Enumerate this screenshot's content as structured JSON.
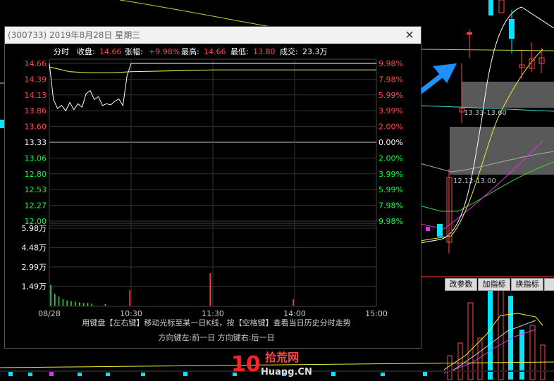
{
  "popup": {
    "title": "(300733) 2019年8月28日 星期三",
    "close_glyph": "✕",
    "info_label": "分时",
    "close_label": "收盘:",
    "close_value": "14.66",
    "change_label": "张幅:",
    "change_value": "+9.98%",
    "high_label": "最高:",
    "high_value": "14.66",
    "low_label": "最低:",
    "low_value": "13.80",
    "volume_label": "成交:",
    "volume_value": "23.3万",
    "price_ticks": [
      "14.66",
      "14.39",
      "14.13",
      "13.86",
      "13.60",
      "13.33",
      "13.06",
      "12.80",
      "12.53",
      "12.27",
      "12.00"
    ],
    "pct_ticks": [
      "9.98%",
      "7.98%",
      "5.99%",
      "3.99%",
      "2.00%",
      "0.00%",
      "2.00%",
      "3.99%",
      "5.99%",
      "7.98%",
      "9.98%"
    ],
    "volume_ticks": [
      "5.98万",
      "4.48万",
      "2.99万",
      "1.49万"
    ],
    "time_ticks": [
      "08/28",
      "10:30",
      "11:30",
      "14:00",
      "15:00"
    ],
    "hint_line1": "用键盘【左右键】移动光标至某一日K线，按【空格键】查看当日历史分时走势",
    "hint_line2": "方向键左:前一日    方向键右:后一日"
  },
  "right_panel": {
    "buttons": [
      "改参数",
      "加指标",
      "换指标"
    ],
    "range_label_top": "13.33-13.60",
    "range_label_bottom": "12.12-13.00"
  },
  "watermark": {
    "logo_number": "10",
    "site_cn": "拾荒网",
    "site_en": "Huang.CN"
  },
  "colors": {
    "background": "#000000",
    "up_red": "#ff4a4a",
    "down_green": "#00ff3c",
    "neutral_white": "#ffffff",
    "average_yellow": "#ffff55",
    "arrow_blue": "#1e90ff"
  },
  "chart_data": {
    "type": "line",
    "title": "分时",
    "x_ticks": [
      "08/28",
      "10:30",
      "11:30",
      "14:00",
      "15:00"
    ],
    "ylim": [
      12.0,
      14.66
    ],
    "prev_close": 13.33,
    "price_series": {
      "x": [
        "09:30",
        "09:33",
        "09:36",
        "09:39",
        "09:42",
        "09:45",
        "09:48",
        "09:51",
        "09:54",
        "09:57",
        "10:00",
        "10:03",
        "10:06",
        "10:09",
        "10:12",
        "10:15",
        "10:18",
        "10:21",
        "10:24",
        "10:27",
        "10:30",
        "11:30",
        "14:00",
        "15:00"
      ],
      "y": [
        14.66,
        14.05,
        13.9,
        13.95,
        13.86,
        14.0,
        13.88,
        13.98,
        13.92,
        14.15,
        14.2,
        14.05,
        14.1,
        13.95,
        13.98,
        13.96,
        14.02,
        14.06,
        13.95,
        14.45,
        14.66,
        14.66,
        14.66,
        14.66
      ]
    },
    "avg_series": {
      "x": [
        "09:30",
        "09:45",
        "10:00",
        "10:15",
        "10:30",
        "11:30",
        "14:00",
        "15:00"
      ],
      "y": [
        14.6,
        14.52,
        14.5,
        14.5,
        14.52,
        14.55,
        14.55,
        14.55
      ]
    },
    "volume": {
      "ylim": [
        0,
        5.98
      ],
      "unit": "万",
      "bars": [
        {
          "t": "09:30",
          "v": 1.6,
          "c": "green"
        },
        {
          "t": "09:33",
          "v": 0.9,
          "c": "green"
        },
        {
          "t": "09:36",
          "v": 0.7,
          "c": "green"
        },
        {
          "t": "09:39",
          "v": 0.5,
          "c": "green"
        },
        {
          "t": "09:42",
          "v": 0.4,
          "c": "green"
        },
        {
          "t": "09:45",
          "v": 0.35,
          "c": "green"
        },
        {
          "t": "09:48",
          "v": 0.3,
          "c": "green"
        },
        {
          "t": "09:51",
          "v": 0.25,
          "c": "green"
        },
        {
          "t": "09:54",
          "v": 0.2,
          "c": "green"
        },
        {
          "t": "09:57",
          "v": 0.2,
          "c": "green"
        },
        {
          "t": "10:00",
          "v": 0.15,
          "c": "green"
        },
        {
          "t": "10:10",
          "v": 0.12,
          "c": "green"
        },
        {
          "t": "10:28",
          "v": 1.2,
          "c": "red"
        },
        {
          "t": "11:27",
          "v": 2.5,
          "c": "red"
        },
        {
          "t": "13:58",
          "v": 0.5,
          "c": "red"
        }
      ]
    }
  }
}
